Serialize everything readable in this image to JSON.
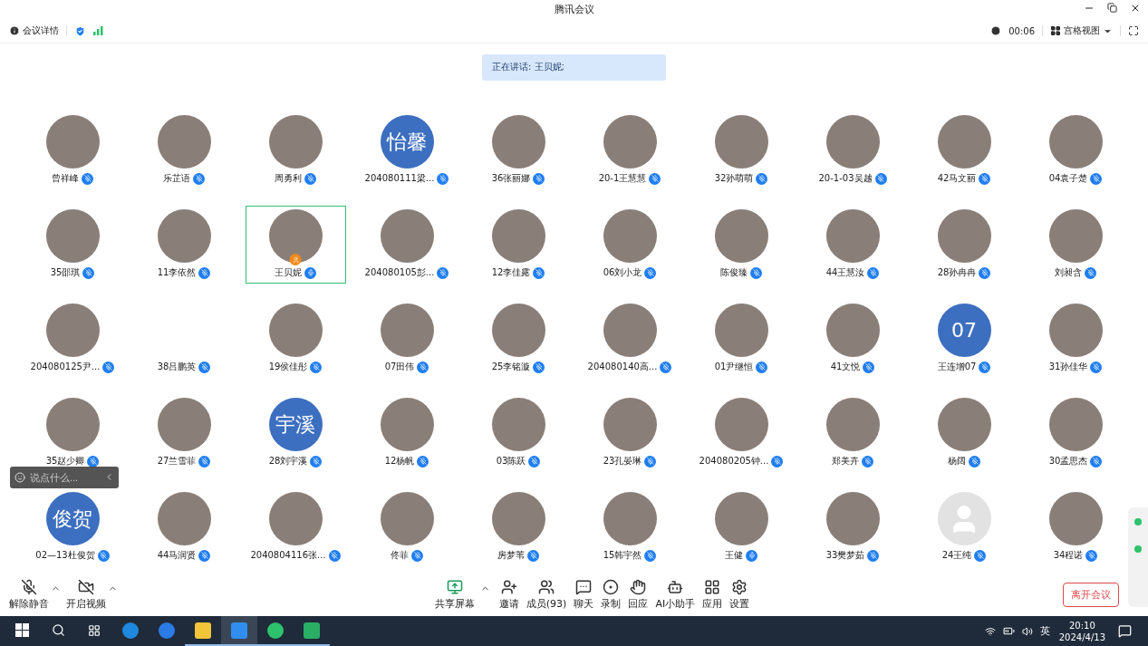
{
  "window": {
    "title": "腾讯会议"
  },
  "info_bar": {
    "details_label": "会议详情",
    "timer": "00:06",
    "view_label": "宫格视图"
  },
  "speaking": "正在讲话: 王贝妮;",
  "participants": [
    {
      "name": "曾祥峰",
      "kind": "photo",
      "muted": true,
      "host": false,
      "selected": false
    },
    {
      "name": "乐芷语",
      "kind": "photo",
      "muted": true,
      "host": false,
      "selected": false
    },
    {
      "name": "周勇利",
      "kind": "photo",
      "muted": true,
      "host": false,
      "selected": false
    },
    {
      "name": "204080111梁...",
      "kind": "text",
      "avatar_text": "怡馨",
      "muted": true,
      "host": false,
      "selected": false
    },
    {
      "name": "36张丽娜",
      "kind": "photo",
      "muted": true,
      "host": false,
      "selected": false
    },
    {
      "name": "20-1王慧慧",
      "kind": "photo",
      "muted": true,
      "host": false,
      "selected": false
    },
    {
      "name": "32孙萌萌",
      "kind": "photo",
      "muted": true,
      "host": false,
      "selected": false
    },
    {
      "name": "20-1-03吴越",
      "kind": "photo",
      "muted": true,
      "host": false,
      "selected": false
    },
    {
      "name": "42马文丽",
      "kind": "photo",
      "muted": true,
      "host": false,
      "selected": false
    },
    {
      "name": "04袁子楚",
      "kind": "photo",
      "muted": true,
      "host": false,
      "selected": false
    },
    {
      "name": "35邵琪",
      "kind": "photo",
      "muted": true,
      "host": false,
      "selected": false
    },
    {
      "name": "11李依然",
      "kind": "photo",
      "muted": true,
      "host": false,
      "selected": false
    },
    {
      "name": "王贝妮",
      "kind": "photo",
      "muted": false,
      "host": true,
      "selected": true
    },
    {
      "name": "204080105彭...",
      "kind": "photo",
      "muted": true,
      "host": false,
      "selected": false
    },
    {
      "name": "12李佳露",
      "kind": "photo",
      "muted": true,
      "host": false,
      "selected": false
    },
    {
      "name": "06刘小龙",
      "kind": "photo",
      "muted": true,
      "host": false,
      "selected": false
    },
    {
      "name": "陈俊臻",
      "kind": "photo",
      "muted": true,
      "host": false,
      "selected": false
    },
    {
      "name": "44王慧汝",
      "kind": "photo",
      "muted": true,
      "host": false,
      "selected": false
    },
    {
      "name": "28孙冉冉",
      "kind": "photo",
      "muted": true,
      "host": false,
      "selected": false
    },
    {
      "name": "刘昶含",
      "kind": "photo",
      "muted": true,
      "host": false,
      "selected": false
    },
    {
      "name": "204080125尹...",
      "kind": "photo",
      "muted": true,
      "host": false,
      "selected": false
    },
    {
      "name": "38吕鹏英",
      "kind": "none",
      "muted": true,
      "host": false,
      "selected": false
    },
    {
      "name": "19侯佳彤",
      "kind": "photo",
      "muted": true,
      "host": false,
      "selected": false
    },
    {
      "name": "07田伟",
      "kind": "photo",
      "muted": true,
      "host": false,
      "selected": false
    },
    {
      "name": "25李铭漩",
      "kind": "photo",
      "muted": true,
      "host": false,
      "selected": false
    },
    {
      "name": "204080140高...",
      "kind": "photo",
      "muted": true,
      "host": false,
      "selected": false
    },
    {
      "name": "01尹继恒",
      "kind": "photo",
      "muted": true,
      "host": false,
      "selected": false
    },
    {
      "name": "41文悦",
      "kind": "photo",
      "muted": true,
      "host": false,
      "selected": false
    },
    {
      "name": "王连增07",
      "kind": "text",
      "avatar_text": "07",
      "muted": true,
      "host": false,
      "selected": false
    },
    {
      "name": "31孙佳华",
      "kind": "photo",
      "muted": true,
      "host": false,
      "selected": false
    },
    {
      "name": "35赵少卿",
      "kind": "photo",
      "muted": true,
      "host": false,
      "selected": false
    },
    {
      "name": "27兰雪菲",
      "kind": "photo",
      "muted": true,
      "host": false,
      "selected": false
    },
    {
      "name": "28刘宇溪",
      "kind": "text",
      "avatar_text": "宇溪",
      "muted": true,
      "host": false,
      "selected": false
    },
    {
      "name": "12杨帆",
      "kind": "photo",
      "muted": true,
      "host": false,
      "selected": false
    },
    {
      "name": "03陈跃",
      "kind": "photo",
      "muted": true,
      "host": false,
      "selected": false
    },
    {
      "name": "23孔晏琳",
      "kind": "photo",
      "muted": true,
      "host": false,
      "selected": false
    },
    {
      "name": "204080205钟...",
      "kind": "photo",
      "muted": true,
      "host": false,
      "selected": false
    },
    {
      "name": "郑美卉",
      "kind": "photo",
      "muted": true,
      "host": false,
      "selected": false
    },
    {
      "name": "杨阔",
      "kind": "photo",
      "muted": true,
      "host": false,
      "selected": false
    },
    {
      "name": "30孟思杰",
      "kind": "photo",
      "muted": true,
      "host": false,
      "selected": false
    },
    {
      "name": "02—13杜俊贺",
      "kind": "text",
      "avatar_text": "俊贺",
      "muted": true,
      "host": false,
      "selected": false
    },
    {
      "name": "44马润贤",
      "kind": "photo",
      "muted": true,
      "host": false,
      "selected": false
    },
    {
      "name": "2040804116张...",
      "kind": "photo",
      "muted": true,
      "host": false,
      "selected": false
    },
    {
      "name": "佟菲",
      "kind": "photo",
      "muted": true,
      "host": false,
      "selected": false
    },
    {
      "name": "房梦苇",
      "kind": "photo",
      "muted": true,
      "host": false,
      "selected": false
    },
    {
      "name": "15韩宇然",
      "kind": "photo",
      "muted": true,
      "host": false,
      "selected": false
    },
    {
      "name": "王健",
      "kind": "photo",
      "muted": false,
      "host": false,
      "selected": false
    },
    {
      "name": "33樊梦茹",
      "kind": "photo",
      "muted": true,
      "host": false,
      "selected": false
    },
    {
      "name": "24王纯",
      "kind": "default",
      "muted": true,
      "host": false,
      "selected": false
    },
    {
      "name": "34程诺",
      "kind": "photo",
      "muted": true,
      "host": false,
      "selected": false
    }
  ],
  "chat_box": {
    "placeholder": "说点什么..."
  },
  "toolbar": {
    "left": [
      {
        "kind": "mic",
        "label": "解除静音"
      },
      {
        "kind": "camera",
        "label": "开启视频"
      }
    ],
    "center": [
      {
        "kind": "share",
        "label": "共享屏幕"
      },
      {
        "kind": "invite",
        "label": "邀请"
      },
      {
        "kind": "members",
        "label": "成员(93)"
      },
      {
        "kind": "chat",
        "label": "聊天"
      },
      {
        "kind": "record",
        "label": "录制"
      },
      {
        "kind": "react",
        "label": "回应"
      },
      {
        "kind": "ai",
        "label": "AI小助手"
      },
      {
        "kind": "apps",
        "label": "应用"
      },
      {
        "kind": "settings",
        "label": "设置"
      }
    ],
    "leave": "离开会议"
  },
  "taskbar": {
    "ime": "英",
    "time": "20:10",
    "date": "2024/4/13"
  }
}
